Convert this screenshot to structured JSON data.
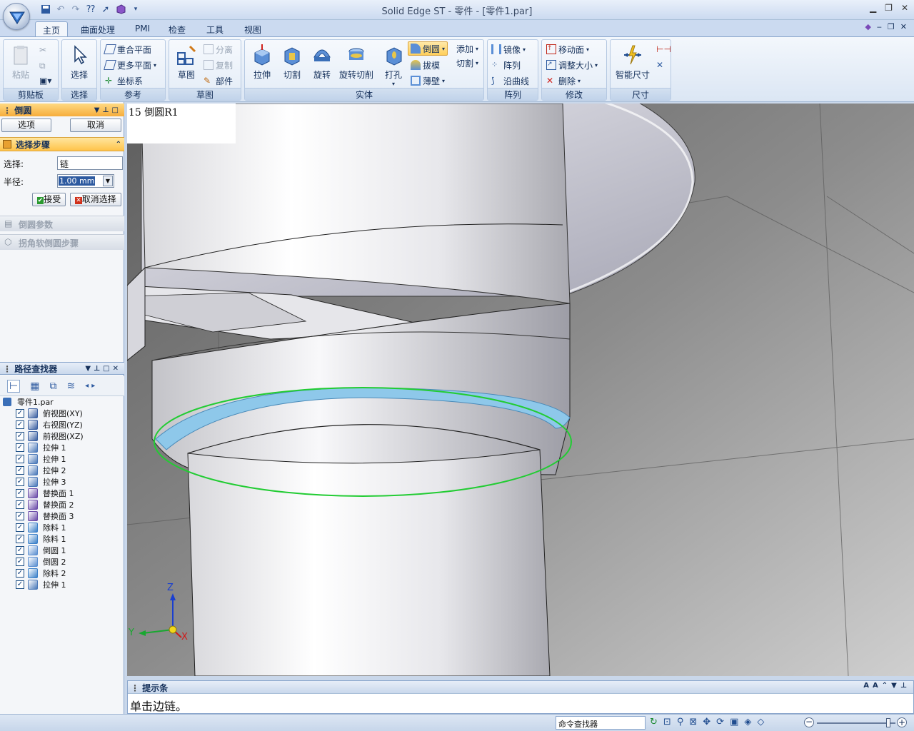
{
  "app": {
    "title": "Solid Edge ST - 零件 - [零件1.par]"
  },
  "tabs": [
    {
      "label": "主页"
    },
    {
      "label": "曲面处理"
    },
    {
      "label": "PMI"
    },
    {
      "label": "检查"
    },
    {
      "label": "工具"
    },
    {
      "label": "视图"
    }
  ],
  "ribbon": {
    "clipboard": {
      "group": "剪贴板",
      "paste": "粘贴"
    },
    "select": {
      "group": "选择",
      "select": "选择"
    },
    "reference": {
      "group": "参考",
      "coincident_plane": "重合平面",
      "more_planes": "更多平面",
      "coord_system": "坐标系"
    },
    "sketch": {
      "group": "草图",
      "sketch": "草图",
      "separate": "分离",
      "copy": "复制",
      "part": "部件"
    },
    "solid": {
      "group": "实体",
      "extrude": "拉伸",
      "cut": "切割",
      "revolve": "旋转",
      "revolve_cut": "旋转切削",
      "hole": "打孔",
      "round": "倒圆",
      "draft": "拔模",
      "thin_wall": "薄壁",
      "add": "添加",
      "cut_drop": "切割"
    },
    "pattern": {
      "group": "阵列",
      "mirror": "镜像",
      "pattern": "阵列",
      "along_curve": "沿曲线"
    },
    "modify": {
      "group": "修改",
      "move_face": "移动面",
      "resize": "调整大小",
      "delete": "删除"
    },
    "dimension": {
      "group": "尺寸",
      "smart_dim": "智能尺寸"
    }
  },
  "command_panel": {
    "title": "倒圆",
    "options_button": "选项",
    "cancel_button": "取消",
    "step_title": "选择步骤",
    "select_label": "选择:",
    "select_value": "链",
    "radius_label": "半径:",
    "radius_value": "1.00 mm",
    "accept_button": "接受",
    "deselect_button": "取消选择",
    "round_params": "倒圆参数",
    "corner_soft_round": "拐角软倒圆步骤"
  },
  "pathfinder": {
    "title": "路径查找器",
    "root": "零件1.par",
    "items": [
      {
        "label": "俯视图(XY)",
        "icon": "plane-icon",
        "color": "#3a5fa0"
      },
      {
        "label": "右视图(YZ)",
        "icon": "plane-icon",
        "color": "#3a5fa0"
      },
      {
        "label": "前视图(XZ)",
        "icon": "plane-icon",
        "color": "#3a5fa0"
      },
      {
        "label": "拉伸 1",
        "icon": "extrude-icon",
        "color": "#4a78b8"
      },
      {
        "label": "拉伸 1",
        "icon": "extrude-icon",
        "color": "#4a78b8"
      },
      {
        "label": "拉伸 2",
        "icon": "extrude-icon",
        "color": "#4a78b8"
      },
      {
        "label": "拉伸 3",
        "icon": "extrude-icon",
        "color": "#4a78b8"
      },
      {
        "label": "替换面 1",
        "icon": "replace-face-icon",
        "color": "#6a4aa8"
      },
      {
        "label": "替换面 2",
        "icon": "replace-face-icon",
        "color": "#6a4aa8"
      },
      {
        "label": "替换面 3",
        "icon": "replace-face-icon",
        "color": "#6a4aa8"
      },
      {
        "label": "除料 1",
        "icon": "cut-icon",
        "color": "#3a7fc8"
      },
      {
        "label": "除料 1",
        "icon": "cut-icon",
        "color": "#3a7fc8"
      },
      {
        "label": "倒圆 1",
        "icon": "round-icon",
        "color": "#5a8ed0"
      },
      {
        "label": "倒圆 2",
        "icon": "round-icon",
        "color": "#5a8ed0"
      },
      {
        "label": "除料 2",
        "icon": "cut-icon",
        "color": "#3a7fc8"
      },
      {
        "label": "拉伸 1",
        "icon": "extrude-icon",
        "color": "#4a78b8"
      }
    ]
  },
  "viewport": {
    "feature_label": "15 倒圆R1",
    "axis_z": "Z",
    "axis_y": "Y",
    "axis_x": "X"
  },
  "prompt_bar": {
    "title": "提示条",
    "message": "单击边链。"
  },
  "statusbar": {
    "command_finder": "命令查找器"
  }
}
